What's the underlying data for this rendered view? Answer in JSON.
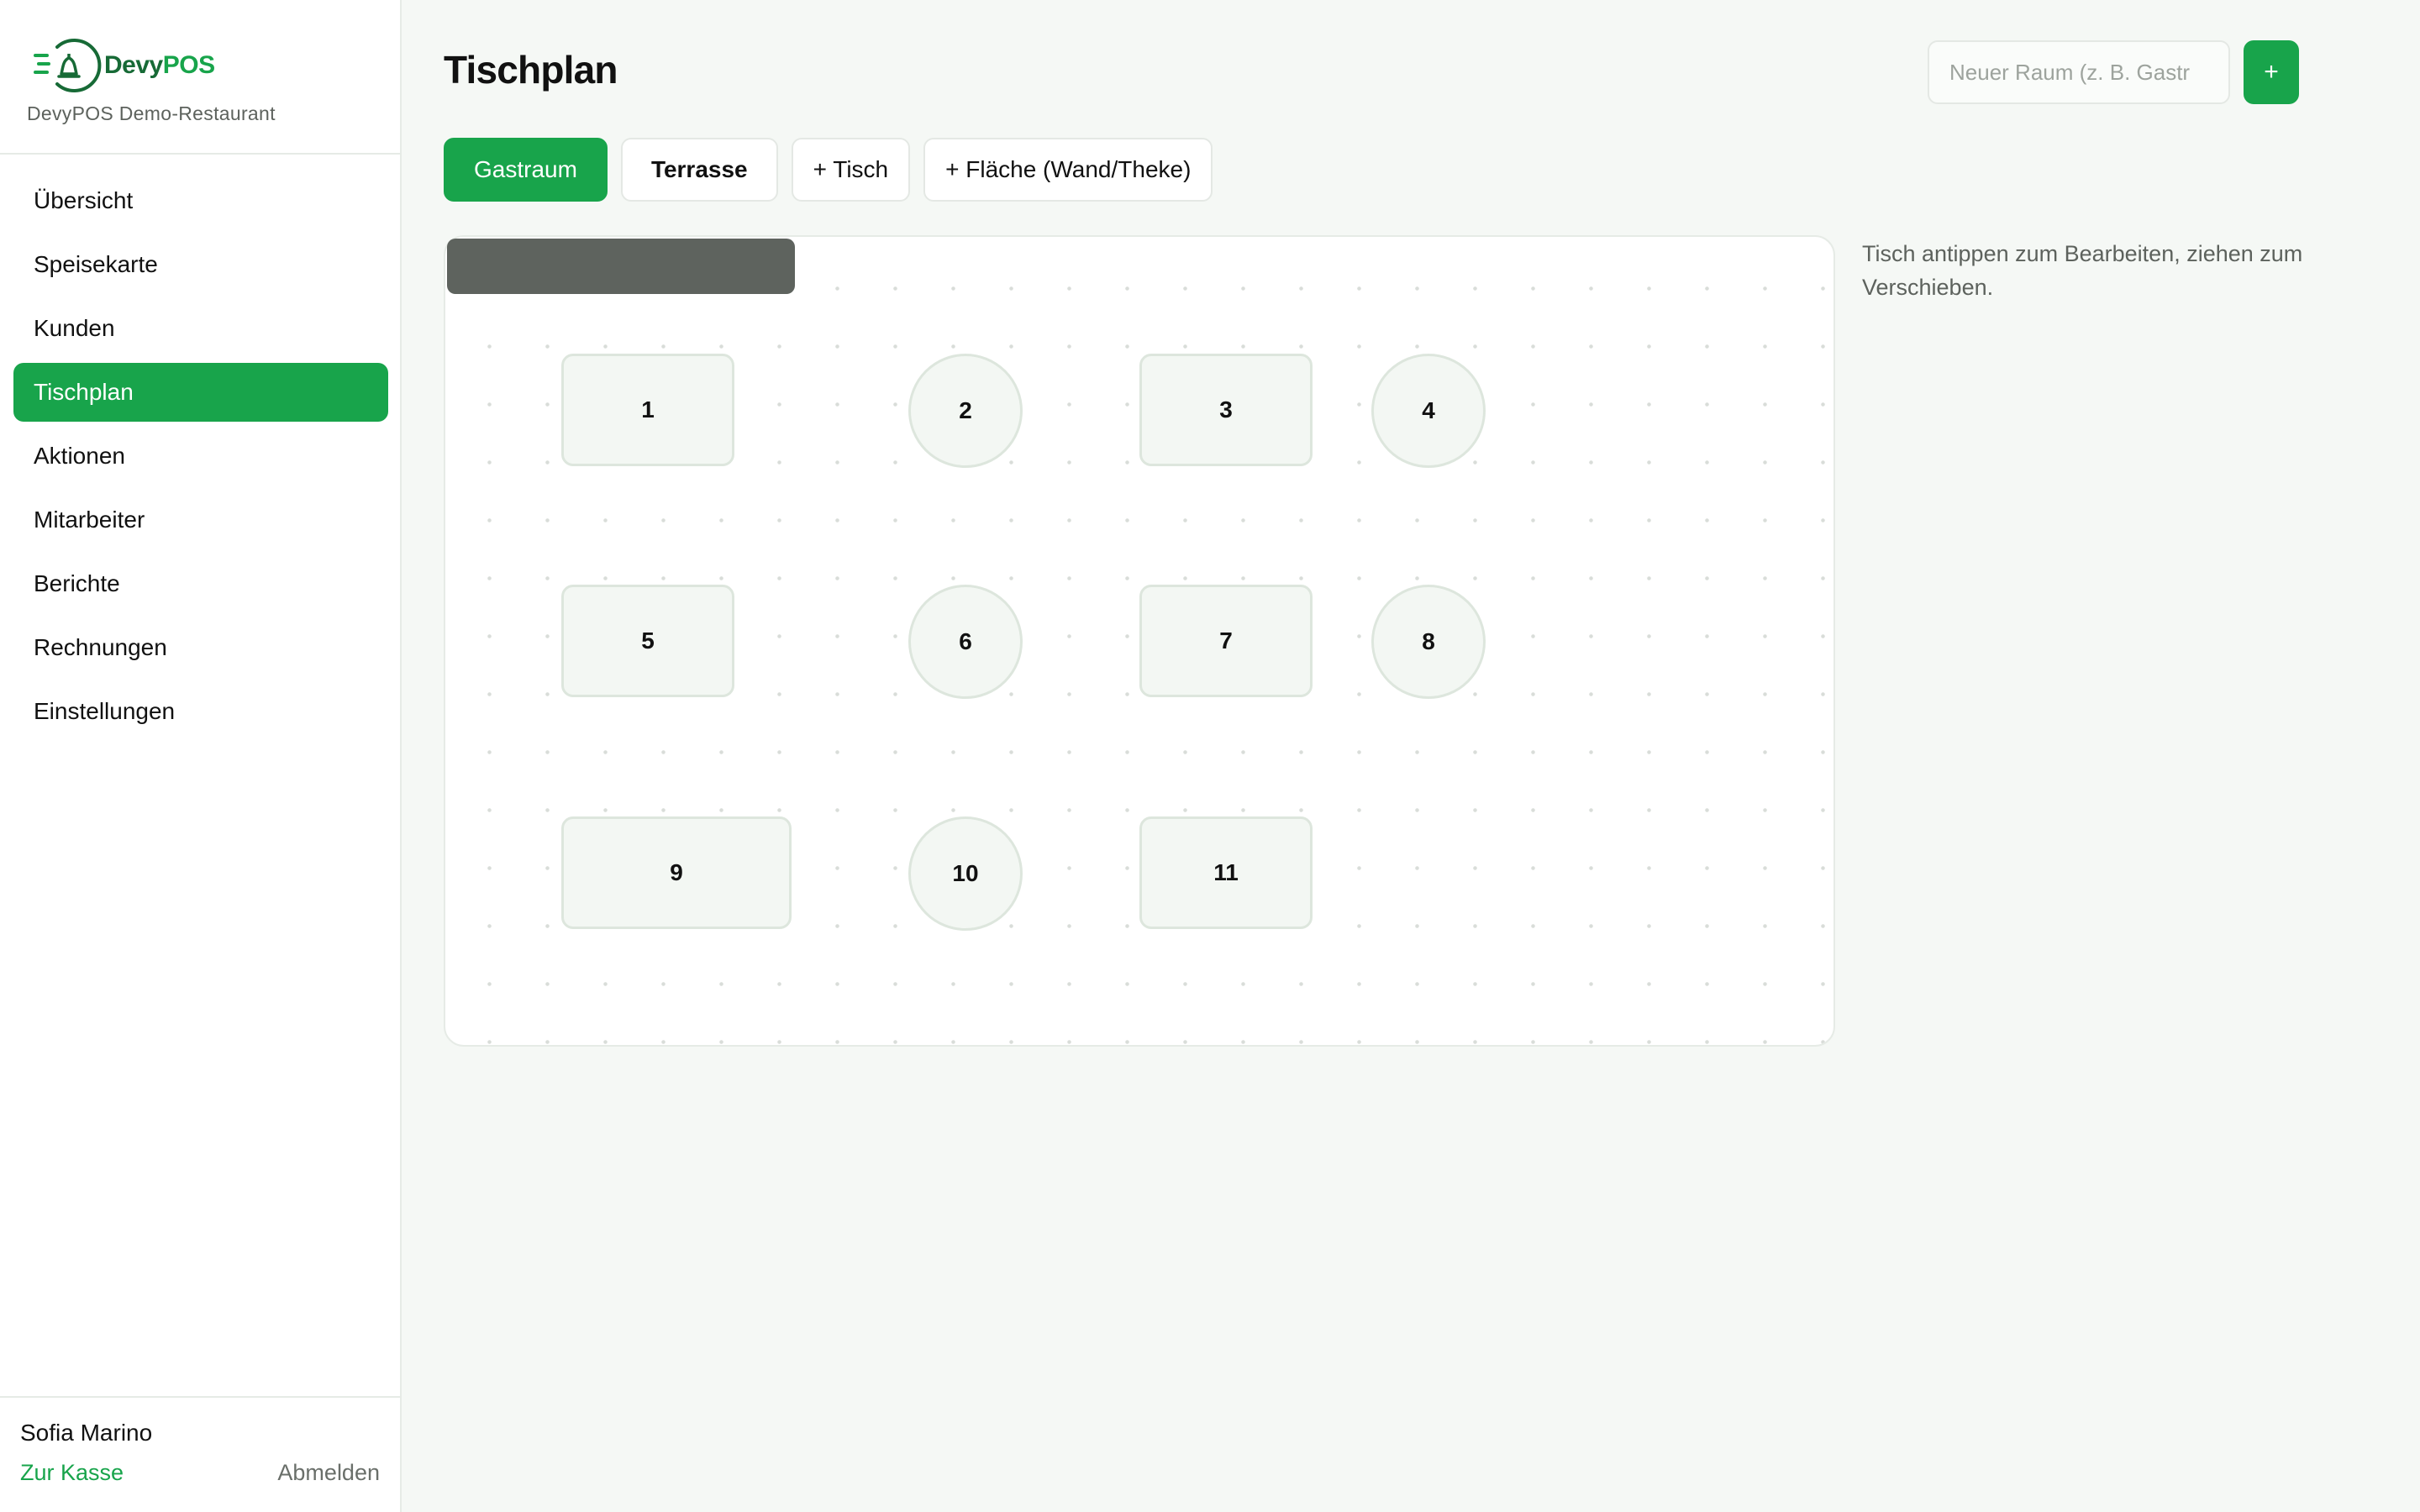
{
  "brand": {
    "logo_text_primary": "Devy",
    "logo_text_accent": "POS",
    "restaurant": "DevyPOS Demo-Restaurant",
    "colors": {
      "primary": "#18a44b",
      "dark": "#176a36"
    }
  },
  "nav": {
    "items": [
      {
        "label": "Übersicht",
        "active": false
      },
      {
        "label": "Speisekarte",
        "active": false
      },
      {
        "label": "Kunden",
        "active": false
      },
      {
        "label": "Tischplan",
        "active": true
      },
      {
        "label": "Aktionen",
        "active": false
      },
      {
        "label": "Mitarbeiter",
        "active": false
      },
      {
        "label": "Berichte",
        "active": false
      },
      {
        "label": "Rechnungen",
        "active": false
      },
      {
        "label": "Einstellungen",
        "active": false
      }
    ]
  },
  "user": {
    "name": "Sofia Marino",
    "to_pos_label": "Zur Kasse",
    "logout_label": "Abmelden"
  },
  "header": {
    "title": "Tischplan",
    "room_input_placeholder": "Neuer Raum (z. B. Gastr",
    "add_room_label": "+"
  },
  "tabs": {
    "rooms": [
      {
        "label": "Gastraum",
        "active": true
      },
      {
        "label": "Terrasse",
        "active": false
      }
    ],
    "add_table_label": "+ Tisch",
    "add_area_label": "+ Fläche (Wand/Theke)"
  },
  "floor": {
    "tables": [
      {
        "label": "1",
        "shape": "rect"
      },
      {
        "label": "2",
        "shape": "round"
      },
      {
        "label": "3",
        "shape": "rect"
      },
      {
        "label": "4",
        "shape": "round"
      },
      {
        "label": "5",
        "shape": "rect"
      },
      {
        "label": "6",
        "shape": "round"
      },
      {
        "label": "7",
        "shape": "rect"
      },
      {
        "label": "8",
        "shape": "round"
      },
      {
        "label": "9",
        "shape": "rect"
      },
      {
        "label": "10",
        "shape": "round"
      },
      {
        "label": "11",
        "shape": "rect"
      }
    ],
    "areas": [
      {
        "type": "wall",
        "color": "#5e635e"
      }
    ]
  },
  "hint": "Tisch antippen zum Bearbeiten, ziehen zum Verschieben."
}
